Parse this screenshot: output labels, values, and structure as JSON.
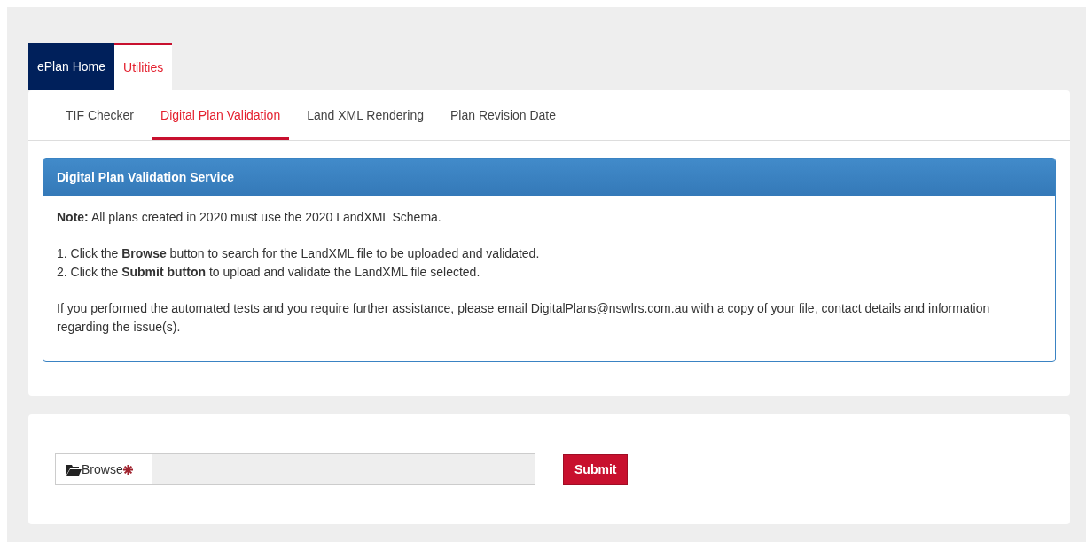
{
  "main_tabs": [
    {
      "label": "ePlan Home",
      "selected": false
    },
    {
      "label": "Utilities",
      "selected": true
    }
  ],
  "sub_tabs": [
    {
      "label": "TIF Checker",
      "selected": false
    },
    {
      "label": "Digital Plan Validation",
      "selected": true
    },
    {
      "label": "Land XML Rendering",
      "selected": false
    },
    {
      "label": "Plan Revision Date",
      "selected": false
    }
  ],
  "panel": {
    "title": "Digital Plan Validation Service",
    "note": "**Note:** All plans created in 2020 must use the 2020 LandXML Schema.",
    "steps": [
      "1. Click the **Browse** button to search for the LandXML file to be uploaded and validated.",
      "2. Click the **Submit button** to upload and validate the LandXML file selected."
    ],
    "help": "If you performed the automated tests and you require further assistance, please email DigitalPlans@nswlrs.com.au with a copy of your file, contact details and information regarding the issue(s)."
  },
  "upload": {
    "browse_label": "Browse",
    "required": true,
    "submit": "Submit"
  }
}
